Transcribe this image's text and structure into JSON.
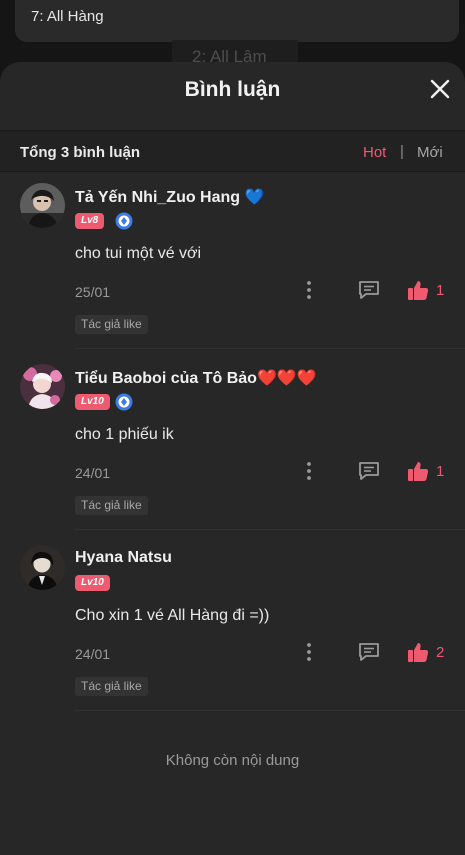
{
  "background": {
    "card_text": "7: All Hàng",
    "faded_tag": "2: All Lâm"
  },
  "sheet": {
    "title": "Bình luận",
    "total_comments": "Tổng 3 bình luận",
    "sort_hot": "Hot",
    "sort_separator": "|",
    "sort_new": "Mới",
    "end_text": "Không còn nội dung"
  },
  "comments": [
    {
      "name": "Tả Yến Nhi_Zuo Hang",
      "name_suffix": "💙",
      "level": "Lv8",
      "text": "cho tui một vé với",
      "date": "25/01",
      "likes": "1",
      "author_like": "Tác giả like"
    },
    {
      "name": "Tiểu Baoboi của Tô Bảo",
      "name_suffix": "❤️❤️❤️",
      "level": "Lv10",
      "text": "cho 1 phiếu ik",
      "date": "24/01",
      "likes": "1",
      "author_like": "Tác giả like"
    },
    {
      "name": "Hyana Natsu",
      "name_suffix": "",
      "level": "Lv10",
      "text": "Cho xin 1 vé All Hàng đi =))",
      "date": "24/01",
      "likes": "2",
      "author_like": "Tác giả like"
    }
  ],
  "colors": {
    "accent": "#ee5a6f",
    "sheet_bg": "#272727",
    "page_bg": "#151515"
  },
  "icons": [
    "close-icon",
    "vip-badge-icon",
    "more-icon",
    "reply-icon",
    "thumbs-up-icon"
  ]
}
